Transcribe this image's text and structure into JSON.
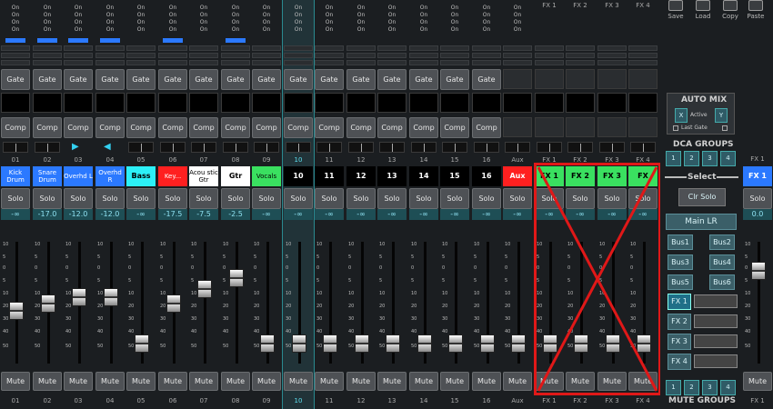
{
  "colors": {
    "accent": "#2a8a90",
    "red_box": "#e01818",
    "db_text": "#8ee0f0"
  },
  "on_labels": [
    "On",
    "On",
    "On",
    "On"
  ],
  "gate_label": "Gate",
  "comp_label": "Comp",
  "solo_label": "Solo",
  "mute_label": "Mute",
  "channels": [
    {
      "num": "01",
      "name": "Kick Drum",
      "color": "#2b79ff",
      "db": "-∞",
      "fader": 0.58,
      "gate": true,
      "comp": true,
      "blue": true
    },
    {
      "num": "02",
      "name": "Snare Drum",
      "color": "#2b79ff",
      "db": "-17.0",
      "fader": 0.52,
      "gate": true,
      "comp": true,
      "blue": true
    },
    {
      "num": "03",
      "name": "Overhd L",
      "color": "#2b79ff",
      "db": "-12.0",
      "fader": 0.46,
      "gate": true,
      "comp": true,
      "blue": true,
      "arrow": "right"
    },
    {
      "num": "04",
      "name": "Overhd R",
      "color": "#2b79ff",
      "db": "-12.0",
      "fader": 0.46,
      "gate": true,
      "comp": true,
      "blue": true,
      "arrow": "left"
    },
    {
      "num": "05",
      "name": "Bass",
      "color": "#2cf0f7",
      "db": "-∞",
      "fader": 0.88,
      "gate": true,
      "comp": true
    },
    {
      "num": "06",
      "name": "Key...",
      "color": "#ff2020",
      "db": "-17.5",
      "fader": 0.52,
      "gate": true,
      "comp": true,
      "blue": true
    },
    {
      "num": "07",
      "name": "Acou stic Gtr",
      "color": "#ffffff",
      "db": "-7.5",
      "fader": 0.38,
      "gate": true,
      "comp": true
    },
    {
      "num": "08",
      "name": "Gtr",
      "color": "#ffffff",
      "db": "-2.5",
      "fader": 0.28,
      "gate": true,
      "comp": true,
      "blue": true
    },
    {
      "num": "09",
      "name": "Vocals",
      "color": "#3ae060",
      "db": "-∞",
      "fader": 0.88,
      "gate": true,
      "comp": true
    },
    {
      "num": "10",
      "name": "10",
      "color": "#000000",
      "db": "-∞",
      "fader": 0.88,
      "gate": true,
      "comp": true,
      "sel": true
    },
    {
      "num": "11",
      "name": "11",
      "color": "#000000",
      "db": "-∞",
      "fader": 0.88,
      "gate": true,
      "comp": true
    },
    {
      "num": "12",
      "name": "12",
      "color": "#000000",
      "db": "-∞",
      "fader": 0.88,
      "gate": true,
      "comp": true
    },
    {
      "num": "13",
      "name": "13",
      "color": "#000000",
      "db": "-∞",
      "fader": 0.88,
      "gate": true,
      "comp": true
    },
    {
      "num": "14",
      "name": "14",
      "color": "#000000",
      "db": "-∞",
      "fader": 0.88,
      "gate": true,
      "comp": true
    },
    {
      "num": "15",
      "name": "15",
      "color": "#000000",
      "db": "-∞",
      "fader": 0.88,
      "gate": true,
      "comp": true
    },
    {
      "num": "16",
      "name": "16",
      "color": "#000000",
      "db": "-∞",
      "fader": 0.88,
      "gate": true,
      "comp": true
    },
    {
      "num": "Aux",
      "name": "Aux",
      "color": "#ff2020",
      "db": "-∞",
      "fader": 0.88,
      "gate": false,
      "comp": false
    },
    {
      "num": "FX 1",
      "name": "FX 1",
      "color": "#3ae060",
      "db": "-∞",
      "fader": 0.88,
      "gate": false,
      "comp": false,
      "topnum": "FX 1"
    },
    {
      "num": "FX 2",
      "name": "FX 2",
      "color": "#3ae060",
      "db": "-∞",
      "fader": 0.88,
      "gate": false,
      "comp": false,
      "topnum": "FX 2"
    },
    {
      "num": "FX 3",
      "name": "FX 3",
      "color": "#3ae060",
      "db": "-∞",
      "fader": 0.88,
      "gate": false,
      "comp": false,
      "topnum": "FX 3"
    },
    {
      "num": "FX 4",
      "name": "FX",
      "color": "#3ae060",
      "db": "-∞",
      "fader": 0.88,
      "gate": false,
      "comp": false,
      "topnum": "FX 4"
    }
  ],
  "scale_labels": [
    "10",
    "5",
    "0",
    "5",
    "10",
    "20",
    "30",
    "40",
    "50"
  ],
  "toolbar": {
    "save": "Save",
    "load": "Load",
    "copy": "Copy",
    "paste": "Paste"
  },
  "automix": {
    "title": "AUTO MIX",
    "x": "X",
    "active": "Active",
    "y": "Y",
    "last_gate": "Last Gate"
  },
  "dca": {
    "title": "DCA GROUPS",
    "buttons": [
      "1",
      "2",
      "3",
      "4"
    ]
  },
  "select_label": "Select",
  "clr_solo": "Clr Solo",
  "main_lr": "Main LR",
  "buses": [
    "Bus1",
    "Bus2",
    "Bus3",
    "Bus4",
    "Bus5",
    "Bus6"
  ],
  "fx_buttons": [
    "FX 1",
    "FX 2",
    "FX 3",
    "FX 4"
  ],
  "mute_groups": {
    "title": "MUTE GROUPS",
    "buttons": [
      "1",
      "2",
      "3",
      "4"
    ]
  },
  "fx_strip": {
    "top": "FX 1",
    "name": "FX 1",
    "db": "0.0",
    "bottom": "FX 1",
    "fader": 0.22
  }
}
